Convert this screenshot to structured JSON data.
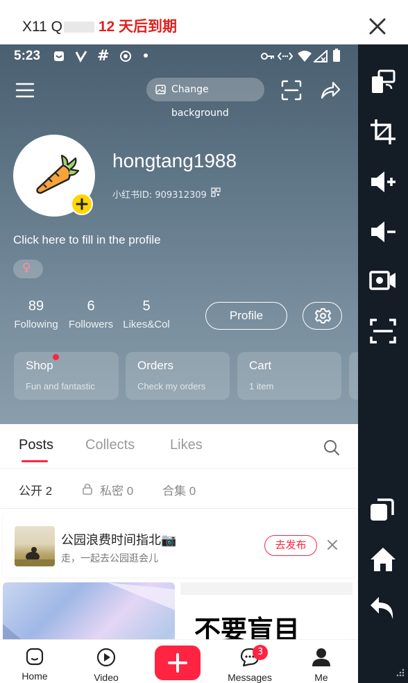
{
  "window": {
    "title_prefix": "X11 Q",
    "title_expire": "12 天后到期"
  },
  "status_bar": {
    "time": "5:23"
  },
  "header": {
    "change_background": "Change background"
  },
  "profile": {
    "username": "hongtang1988",
    "user_id": "小红书ID: 909312309",
    "bio": "Click here to fill in the profile",
    "gender_symbol": "♀"
  },
  "stats": [
    {
      "num": "89",
      "label": "Following"
    },
    {
      "num": "6",
      "label": "Followers"
    },
    {
      "num": "5",
      "label": "Likes&Col"
    }
  ],
  "buttons": {
    "profile": "Profile"
  },
  "cards": [
    {
      "title": "Shop",
      "subtitle": "Fun and fantastic"
    },
    {
      "title": "Orders",
      "subtitle": "Check my orders"
    },
    {
      "title": "Cart",
      "subtitle": "1 item"
    }
  ],
  "tabs": [
    {
      "label": "Posts",
      "active": true
    },
    {
      "label": "Collects",
      "active": false
    },
    {
      "label": "Likes",
      "active": false
    }
  ],
  "subtabs": [
    {
      "label": "公开 2"
    },
    {
      "label": "私密 0"
    },
    {
      "label": "合集 0"
    }
  ],
  "draft": {
    "title": "公园浪费时间指北📷",
    "subtitle": "走，一起去公园逛会儿",
    "publish": "去发布"
  },
  "thumb2": {
    "headline": "不要盲目"
  },
  "bottom_nav": [
    {
      "label": "Home"
    },
    {
      "label": "Video"
    },
    {
      "label": "Messages",
      "badge": "3"
    },
    {
      "label": "Me"
    }
  ],
  "colors": {
    "accent": "#ff2442",
    "add_badge": "#ffd600",
    "side_toolbar": "#141c26"
  }
}
